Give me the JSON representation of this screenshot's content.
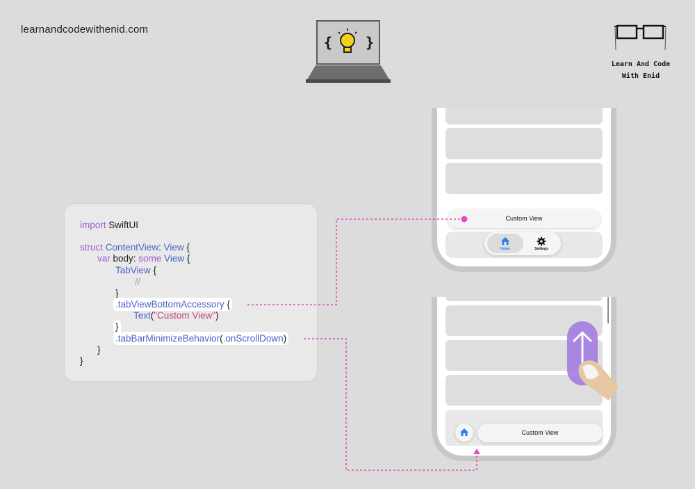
{
  "header": {
    "site_url": "learnandcodewithenid.com",
    "brand_line1": "Learn And Code",
    "brand_line2": "With Enid",
    "logo_braces_left": "{",
    "logo_braces_right": "}"
  },
  "code": {
    "l1_kw": "import",
    "l1_rest": " SwiftUI",
    "l2_kw": "struct",
    "l2_name": " ContentView",
    "l2_colon": ": ",
    "l2_type": "View",
    "l2_brace": " {",
    "l3_kw": "var",
    "l3_body": " body: ",
    "l3_some": "some",
    "l3_type": " View",
    "l3_brace": " {",
    "l4_type": "TabView",
    "l4_brace": " {",
    "l5_comment": "//",
    "l6": "}",
    "l7_mod": ".tabViewBottomAccessory",
    "l7_brace": " {",
    "l8_type": "Text",
    "l8_open": "(",
    "l8_str": "\"Custom View\"",
    "l8_close": ")",
    "l9": "}",
    "l10_mod": ".tabBarMinimizeBehavior",
    "l10_open": "(",
    "l10_arg": ".onScrollDown",
    "l10_close": ")",
    "l11": "}",
    "l12": "}"
  },
  "phone_top": {
    "accessory_label": "Custom View",
    "tabs": [
      {
        "label": "Home",
        "icon": "house-icon",
        "selected": true
      },
      {
        "label": "Settings",
        "icon": "gear-icon",
        "selected": false
      }
    ]
  },
  "phone_bottom": {
    "accessory_label": "Custom View",
    "minimized_tab_icon": "house-icon",
    "gesture": "scroll-up-arrow"
  },
  "colors": {
    "connector": "#e24cc0",
    "accent_blue": "#2f7df6",
    "keyword": "#a05bd3",
    "type": "#4a62c9",
    "string": "#c4457a",
    "gesture_purple": "#a47ee0"
  }
}
